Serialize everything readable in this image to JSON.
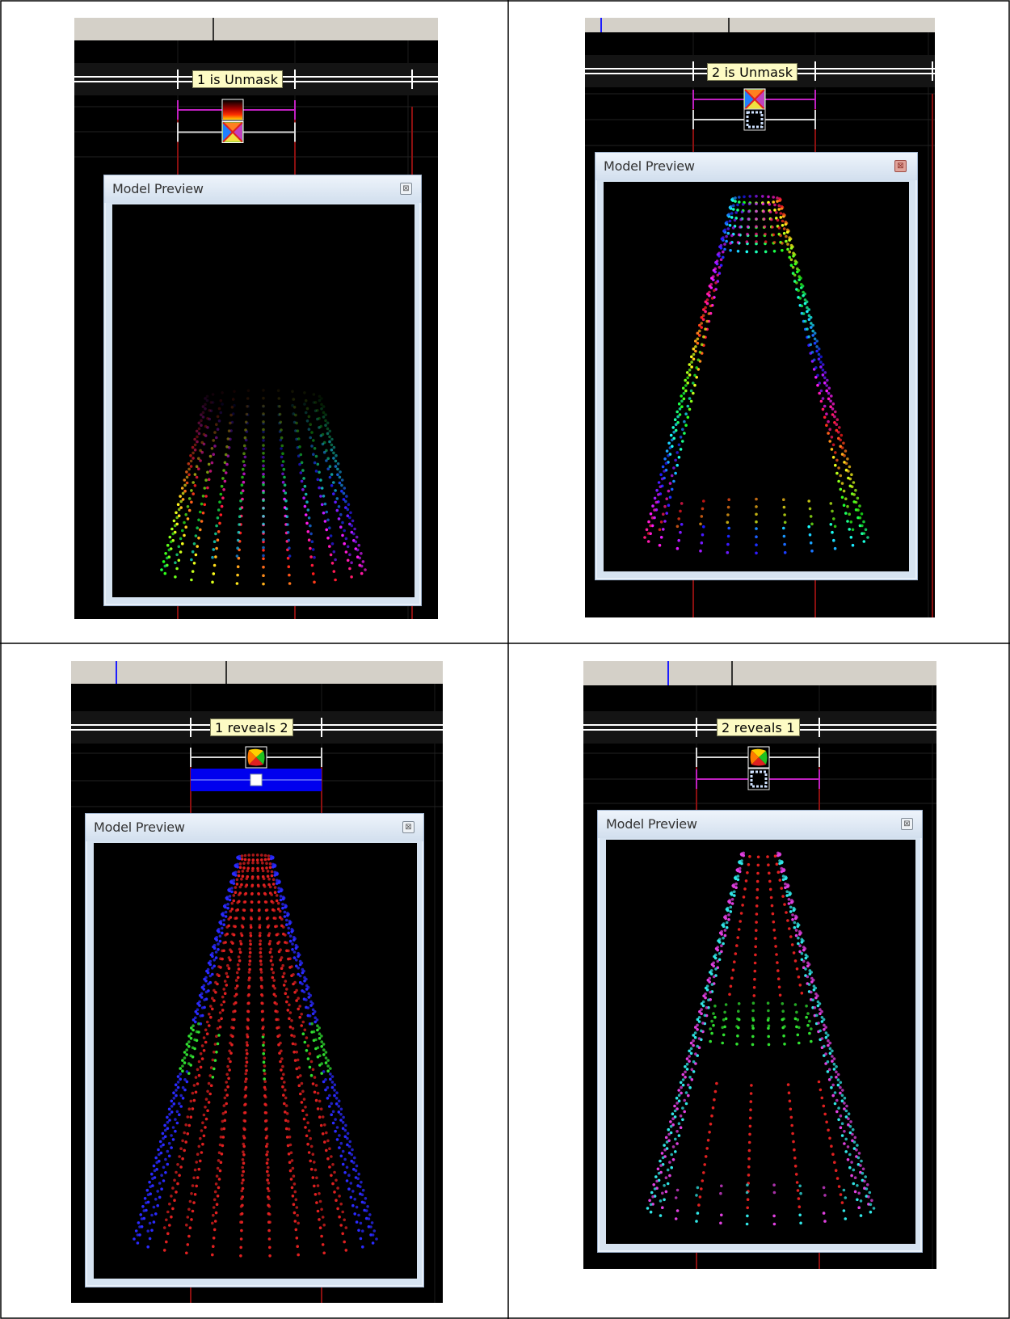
{
  "panels": [
    {
      "label": "1 is Unmask",
      "window_title": "Model Preview",
      "close_glyph": "⊠",
      "close_style": "gray",
      "pattern": "unmask-1",
      "icon_top": "fire-effect-icon",
      "icon_bottom": "butterfly-effect-icon",
      "bar": "none"
    },
    {
      "label": "2 is Unmask",
      "window_title": "Model Preview",
      "close_glyph": "⊠",
      "close_style": "red",
      "pattern": "unmask-2",
      "icon_top": "butterfly-effect-icon",
      "icon_bottom": "off-effect-icon",
      "bar": "none"
    },
    {
      "label": "1 reveals 2",
      "window_title": "Model Preview",
      "close_glyph": "⊠",
      "close_style": "gray",
      "pattern": "reveal-1-2",
      "icon_top": "pinwheel-effect-icon",
      "icon_bottom": "selected-effect-icon",
      "bar": "blue"
    },
    {
      "label": "2 reveals 1",
      "window_title": "Model Preview",
      "close_glyph": "⊠",
      "close_style": "gray",
      "pattern": "reveal-2-1",
      "icon_top": "pinwheel-effect-icon",
      "icon_bottom": "off-effect-icon",
      "bar": "none"
    }
  ],
  "colors": {
    "timeline_header": "#d4d0c8",
    "grid_line": "#1c1c1c",
    "marker_red": "#8b1010",
    "selection_magenta": "#c020c0",
    "selection_blue": "#0000ee",
    "playhead_blue": "#1c1cff"
  }
}
